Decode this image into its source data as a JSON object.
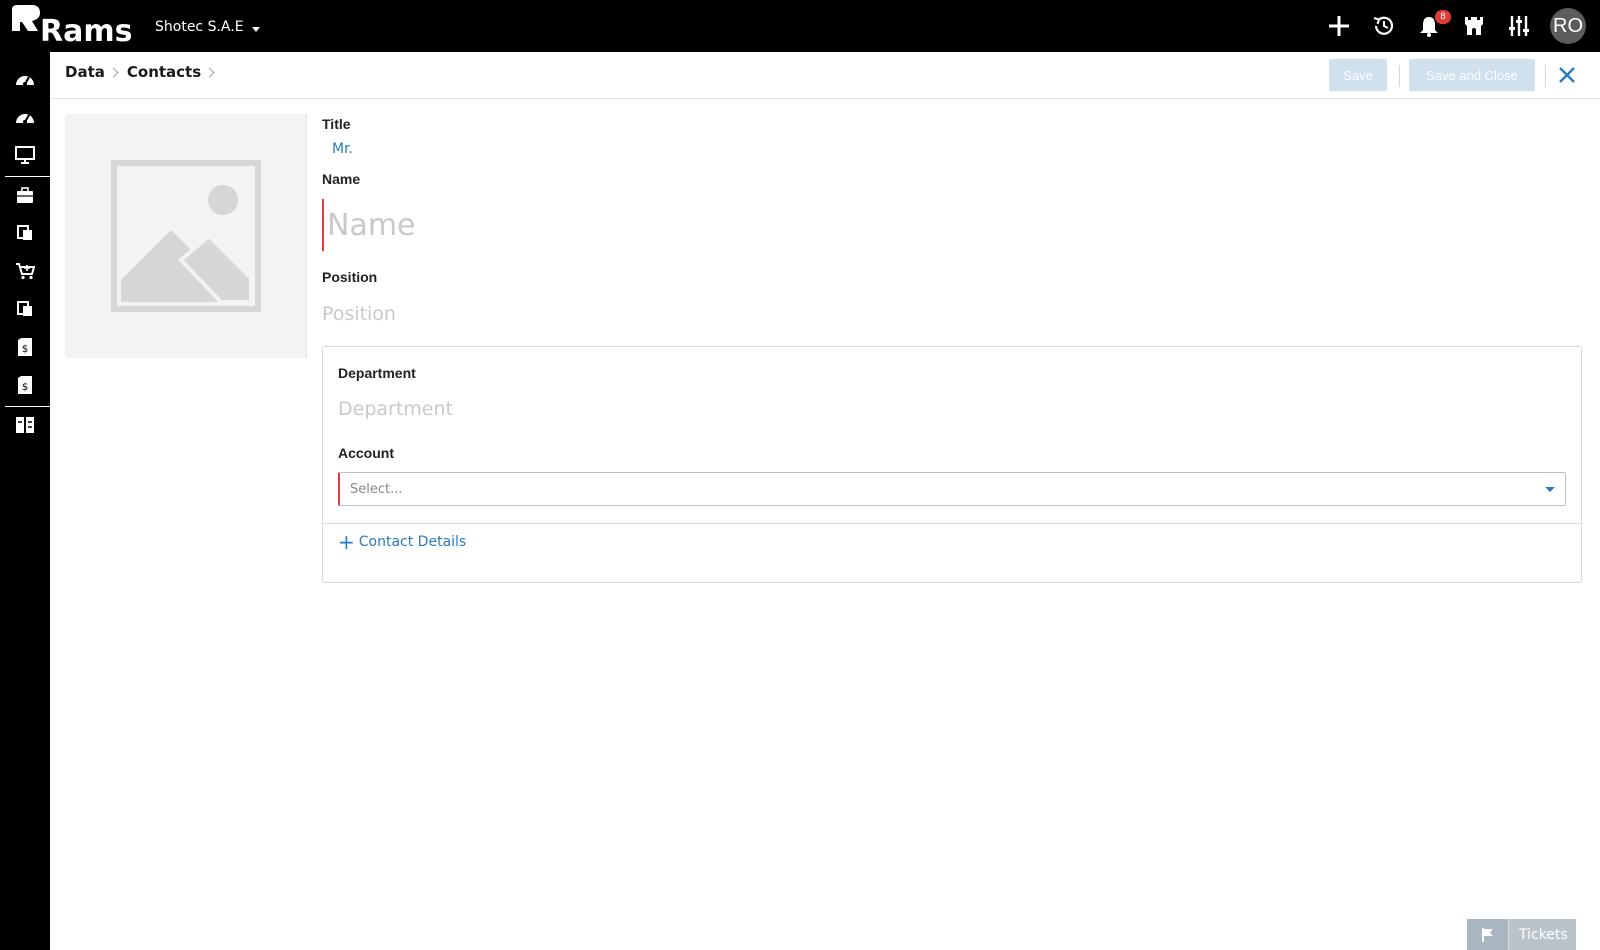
{
  "brand": {
    "logo_text": "Rams"
  },
  "header": {
    "company": "Shotec S.A.E",
    "notification_count": "8",
    "avatar_initials": "RO"
  },
  "breadcrumb": {
    "items": [
      "Data",
      "Contacts"
    ]
  },
  "toolbar": {
    "save_label": "Save",
    "save_close_label": "Save and Close"
  },
  "form": {
    "title_label": "Title",
    "title_value": "Mr.",
    "name_label": "Name",
    "name_placeholder": "Name",
    "position_label": "Position",
    "position_placeholder": "Position",
    "department_label": "Department",
    "department_placeholder": "Department",
    "account_label": "Account",
    "account_placeholder": "Select...",
    "contact_details_link": "Contact Details"
  },
  "footer": {
    "tickets_label": "Tickets"
  },
  "colors": {
    "accent": "#2a7bbf",
    "required": "#e53935",
    "topbar": "#000000",
    "disabled_button": "#cfe0ee"
  },
  "icons": {
    "sidebar": [
      "dashboard-icon",
      "dashboard-icon",
      "monitor-icon",
      "briefcase-icon",
      "documents-icon",
      "cart-icon",
      "documents-icon",
      "invoice-icon",
      "invoice-icon",
      "columns-icon"
    ],
    "top": [
      "plus-icon",
      "history-icon",
      "bell-icon",
      "castle-icon",
      "sliders-icon"
    ]
  }
}
